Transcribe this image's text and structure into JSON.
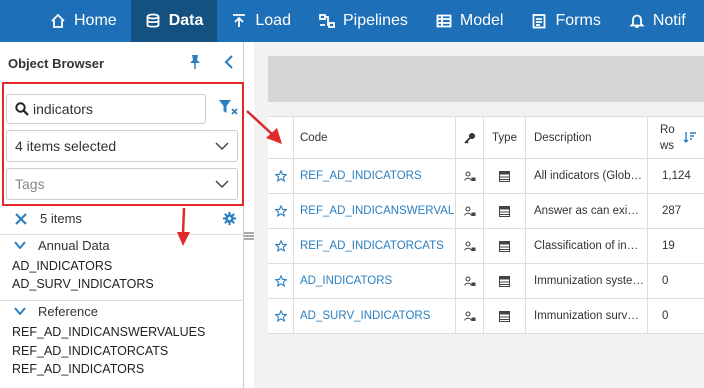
{
  "nav": {
    "items": [
      {
        "label": "Home",
        "icon": "home-icon"
      },
      {
        "label": "Data",
        "icon": "database-icon"
      },
      {
        "label": "Load",
        "icon": "upload-icon"
      },
      {
        "label": "Pipelines",
        "icon": "pipelines-icon"
      },
      {
        "label": "Model",
        "icon": "model-icon"
      },
      {
        "label": "Forms",
        "icon": "forms-icon"
      },
      {
        "label": "Notif",
        "icon": "bell-icon"
      }
    ],
    "active": "Data",
    "colors": {
      "bar": "#1d6fb8",
      "active": "#145080"
    }
  },
  "sidebar": {
    "title": "Object Browser",
    "search": {
      "value": "indicators",
      "placeholder": "Search"
    },
    "selection": "4 items selected",
    "tags_placeholder": "Tags",
    "items_count": "5 items",
    "groups": [
      {
        "label": "Annual Data",
        "items": [
          "AD_INDICATORS",
          "AD_SURV_INDICATORS"
        ]
      },
      {
        "label": "Reference",
        "items": [
          "REF_AD_INDICANSWERVALUES",
          "REF_AD_INDICATORCATS",
          "REF_AD_INDICATORS"
        ]
      }
    ]
  },
  "table": {
    "headers": {
      "code": "Code",
      "type": "Type",
      "description": "Description",
      "rows": "Rows"
    },
    "rows": [
      {
        "code": "REF_AD_INDICATORS",
        "description": "All indicators (Global ...",
        "rows": "1,124"
      },
      {
        "code": "REF_AD_INDICANSWERVAL...",
        "description": "Answer as can exist in...",
        "rows": "287"
      },
      {
        "code": "REF_AD_INDICATORCATS",
        "description": "Classification of indic...",
        "rows": "19"
      },
      {
        "code": "AD_INDICATORS",
        "description": "Immunization system ...",
        "rows": "0"
      },
      {
        "code": "AD_SURV_INDICATORS",
        "description": "Immunization surveill...",
        "rows": "0"
      }
    ]
  },
  "annotation_color": "#e0292a"
}
